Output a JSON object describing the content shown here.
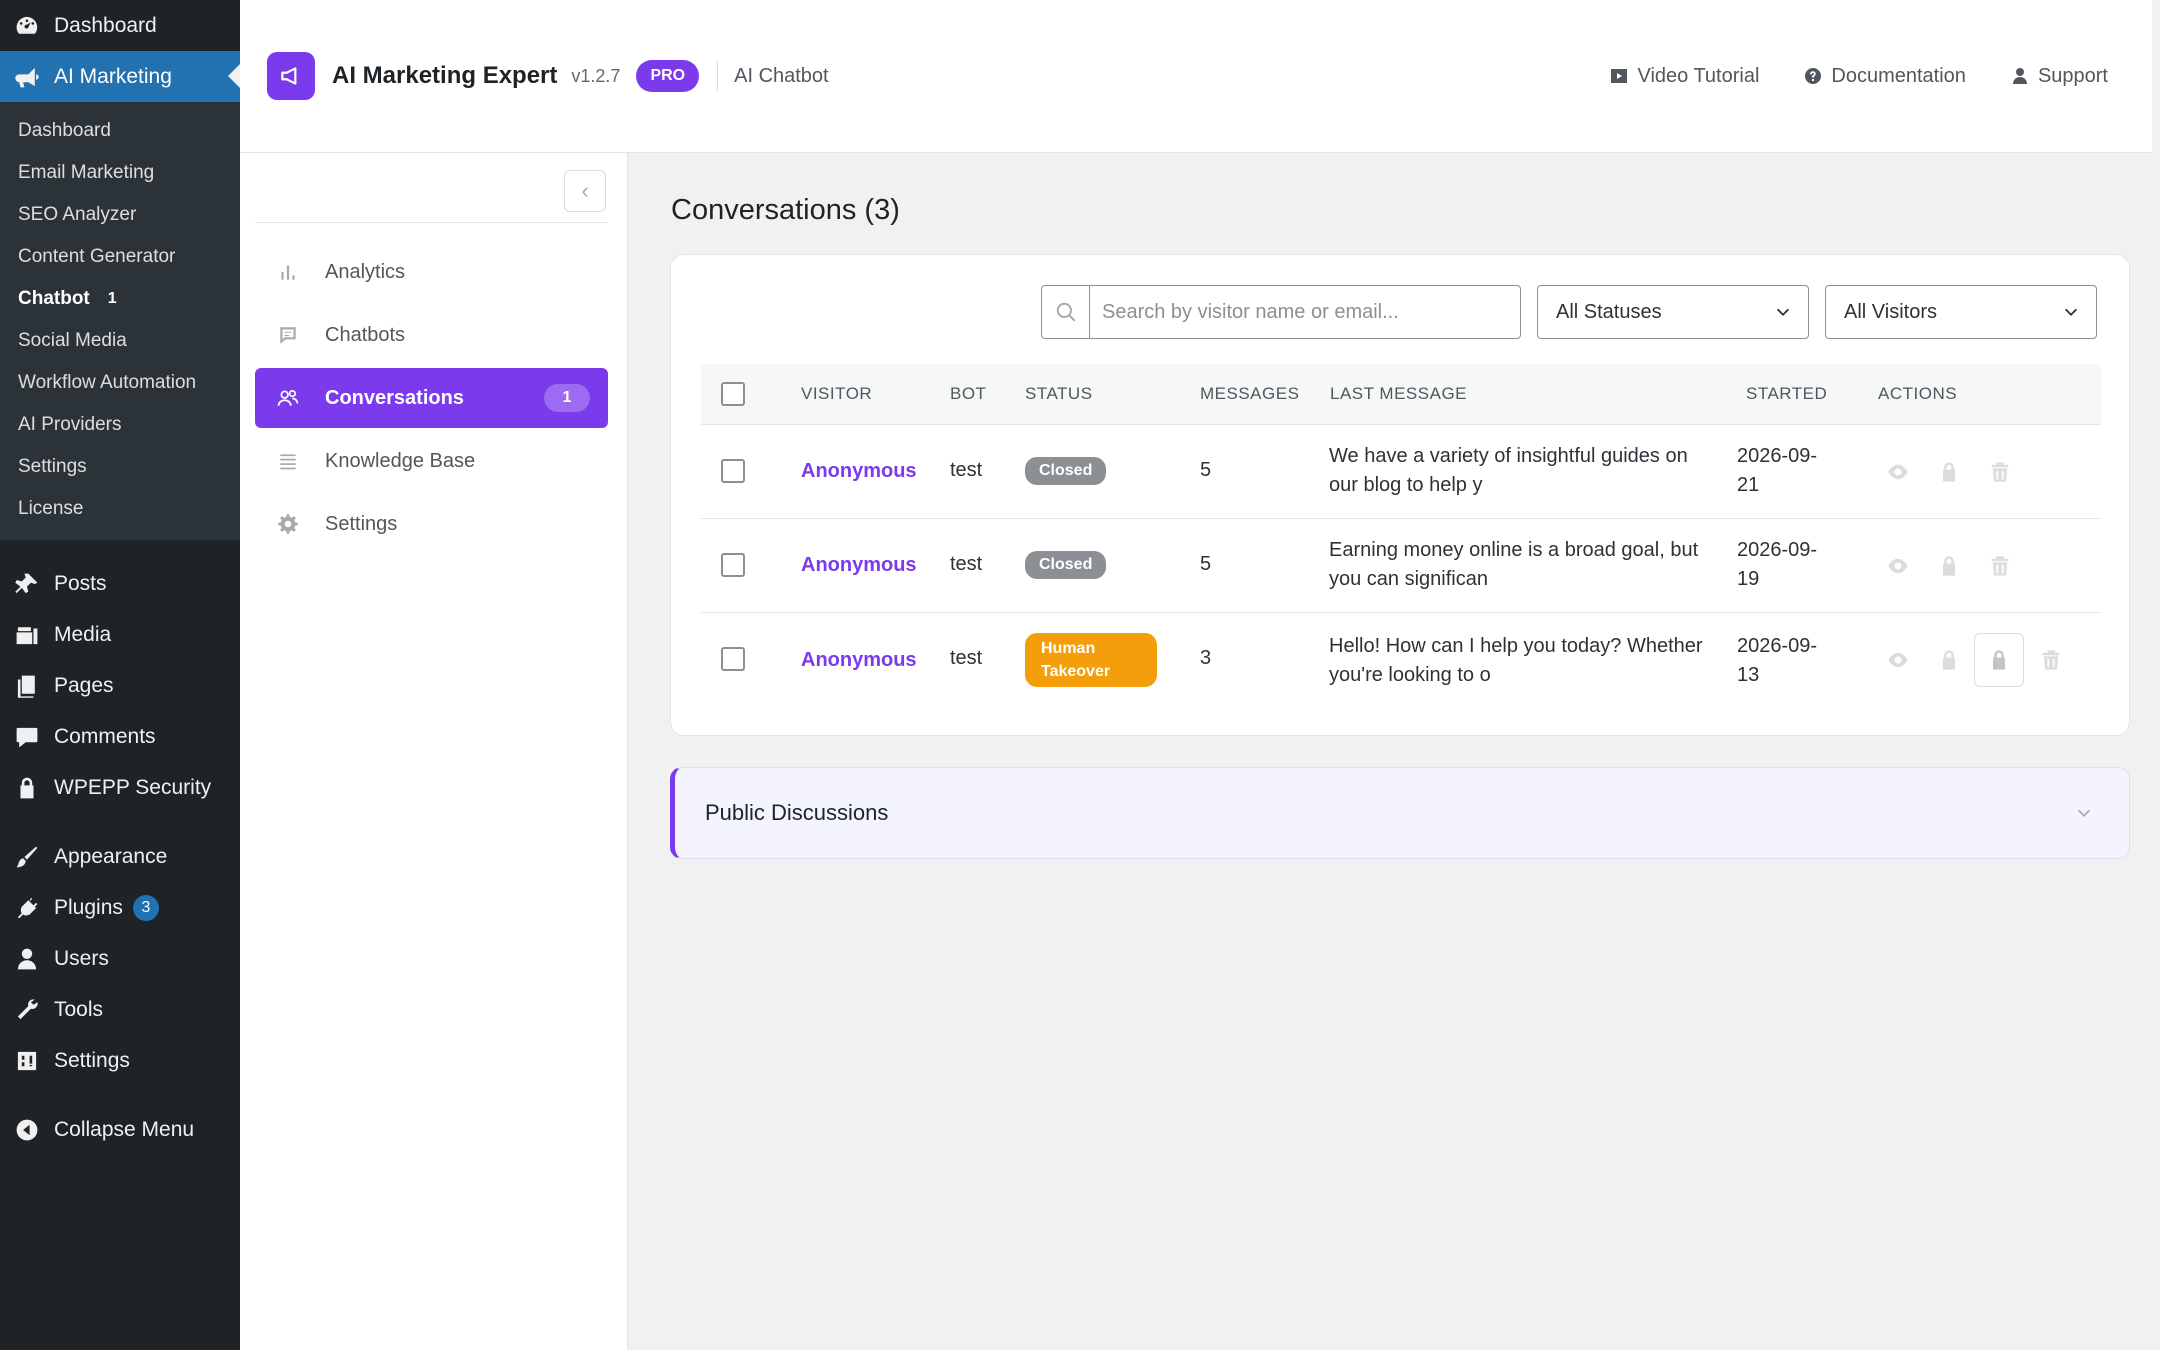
{
  "wp_menu": {
    "top": [
      {
        "label": "Dashboard",
        "icon": "dashboard-icon"
      },
      {
        "label": "AI Marketing",
        "icon": "megaphone-icon",
        "active": true
      }
    ],
    "submenu": [
      {
        "label": "Dashboard"
      },
      {
        "label": "Email Marketing"
      },
      {
        "label": "SEO Analyzer"
      },
      {
        "label": "Content Generator"
      },
      {
        "label": "Chatbot",
        "count": "1",
        "current": true
      },
      {
        "label": "Social Media"
      },
      {
        "label": "Workflow Automation"
      },
      {
        "label": "AI Providers"
      },
      {
        "label": "Settings"
      },
      {
        "label": "License"
      }
    ],
    "group1": [
      {
        "label": "Posts",
        "icon": "pin-icon"
      },
      {
        "label": "Media",
        "icon": "media-icon"
      },
      {
        "label": "Pages",
        "icon": "pages-icon"
      },
      {
        "label": "Comments",
        "icon": "comments-icon"
      },
      {
        "label": "WPEPP Security",
        "icon": "lock-icon"
      }
    ],
    "group2": [
      {
        "label": "Appearance",
        "icon": "brush-icon"
      },
      {
        "label": "Plugins",
        "icon": "plug-icon",
        "badge": "3"
      },
      {
        "label": "Users",
        "icon": "user-icon"
      },
      {
        "label": "Tools",
        "icon": "wrench-icon"
      },
      {
        "label": "Settings",
        "icon": "settings-icon"
      }
    ],
    "collapse_label": "Collapse Menu"
  },
  "header": {
    "title": "AI Marketing Expert",
    "version": "v1.2.7",
    "pro_label": "PRO",
    "section": "AI Chatbot",
    "links": [
      {
        "label": "Video Tutorial",
        "icon": "video-icon"
      },
      {
        "label": "Documentation",
        "icon": "help-icon"
      },
      {
        "label": "Support",
        "icon": "support-icon"
      }
    ]
  },
  "plugin_nav": {
    "collapse_glyph": "‹",
    "items": [
      {
        "label": "Analytics",
        "icon": "analytics-icon"
      },
      {
        "label": "Chatbots",
        "icon": "chatbots-icon"
      },
      {
        "label": "Conversations",
        "icon": "conversations-icon",
        "active": true,
        "count": "1"
      },
      {
        "label": "Knowledge Base",
        "icon": "knowledge-base-icon"
      },
      {
        "label": "Settings",
        "icon": "settings-icon"
      }
    ]
  },
  "main": {
    "title": "Conversations (3)",
    "search_placeholder": "Search by visitor name or email...",
    "status_filter": "All Statuses",
    "visitor_filter": "All Visitors",
    "columns": [
      "VISITOR",
      "BOT",
      "STATUS",
      "MESSAGES",
      "LAST MESSAGE",
      "STARTED",
      "ACTIONS"
    ],
    "rows": [
      {
        "visitor": "Anonymous",
        "bot": "test",
        "status": "Closed",
        "status_type": "closed",
        "messages": "5",
        "last_message": "We have a variety of insightful guides on our blog to help y",
        "started": "2026-09-21"
      },
      {
        "visitor": "Anonymous",
        "bot": "test",
        "status": "Closed",
        "status_type": "closed",
        "messages": "5",
        "last_message": "Earning money online is a broad goal, but you can significan",
        "started": "2026-09-19"
      },
      {
        "visitor": "Anonymous",
        "bot": "test",
        "status": "Human Takeover",
        "status_type": "takeover",
        "messages": "3",
        "last_message": "Hello! How can I help you today? Whether you're looking to o",
        "started": "2026-09-13"
      }
    ],
    "public_discussions": "Public Discussions"
  },
  "colors": {
    "accent": "#7c3aed",
    "wp_active": "#2271b1",
    "takeover": "#f59e0b",
    "closed": "#8c8f94"
  }
}
